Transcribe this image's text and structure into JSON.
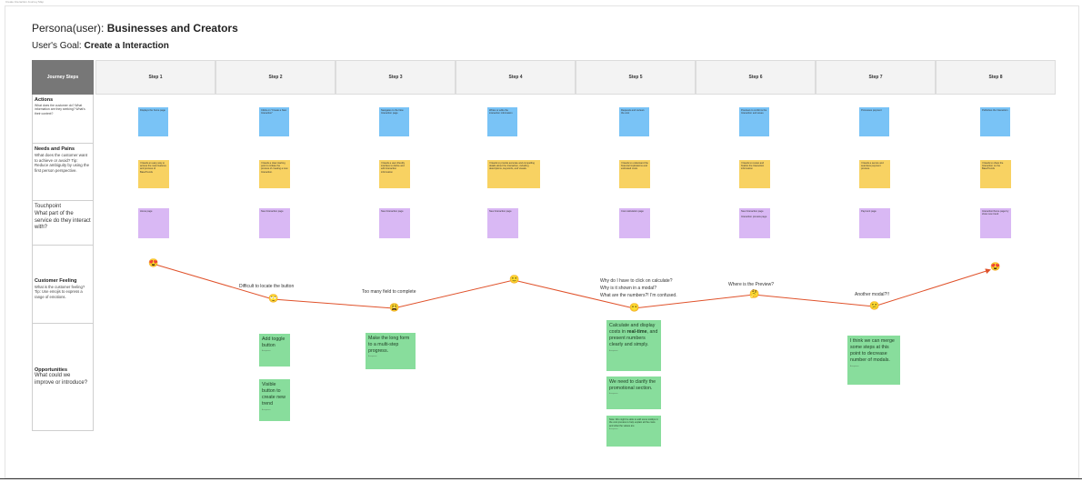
{
  "tiny_label": "Create Interaction Journey Map",
  "persona": {
    "prefix": "Persona(user): ",
    "name": "Businesses and Creators"
  },
  "goal": {
    "prefix": "User's Goal: ",
    "name": "Create a Interaction"
  },
  "journey_label": "Journey Steps",
  "steps": [
    "Step 1",
    "Step 2",
    "Step 3",
    "Step 4",
    "Step 5",
    "Step 6",
    "Step 7",
    "Step 8"
  ],
  "rows": {
    "actions": {
      "title": "Actions",
      "desc": "What does the customer do? What information are they seeking? What's their context?"
    },
    "needs": {
      "title": "Needs and Pains",
      "desc": "What does the customer want to achieve or avoid? Tip: Reduce ambiguity by using the first person perspective."
    },
    "touchpoint": {
      "title": "Touchpoint",
      "desc": "What part of the service do they interact with?"
    },
    "feeling": {
      "title": "Customer Feeling",
      "desc": "What is the customer feeling? Tip: Use emojis to express a range of emotions."
    },
    "opportunities": {
      "title": "Opportunities",
      "desc": "What could we improve or introduce?"
    }
  },
  "actions": [
    "Displays the home page",
    "Clicks on \"Create a New Interaction\"",
    "Navigates to the New Interaction page",
    "Writes or edits the interaction information",
    "Requests and reviews the cost",
    "Previews to confirms the Interaction and saves",
    "Processes payment",
    "Publishes the Interaction"
  ],
  "needs": [
    "I Needs an easy way to access the main features and process of BaseTrends",
    "I Needs a clear starting point to initiate the process of creating a new Interaction.",
    "I Needs a user-friendly interface to define and edit Interaction information",
    "I Needs to provide accurate and compelling details about the Interaction, including descriptions, keywords, and visuals.",
    "I Needs to understand the financial implications and estimated costs",
    "I Needs to review and finalize the Interaction information",
    "I Needs a secure and seamless payment process.",
    "I Needs to share the Interaction on the BaseTrends"
  ],
  "touchpoints": [
    "Home page",
    "New Interaction page",
    "New Interaction page",
    "New Interaction page",
    "Cost calculation page",
    "New Interaction page\n\nInteraction preview page",
    "Payment page",
    "Interaction/home page by show new trend"
  ],
  "feelings": [
    {
      "emoji": "😍",
      "label": ""
    },
    {
      "emoji": "🙄",
      "label": "Difficult to locate the button"
    },
    {
      "emoji": "😩",
      "label": "Too many field to complete"
    },
    {
      "emoji": "🙂",
      "label": ""
    },
    {
      "emoji": "😶",
      "label": "Why do I have to click on calculate?\nWhy is it shown in a modal?\nWhat are the numbers?! I'm confused."
    },
    {
      "emoji": "🤔",
      "label": "Where is the Preview?"
    },
    {
      "emoji": "😕",
      "label": "Another modal?!!"
    },
    {
      "emoji": "😍",
      "label": ""
    }
  ],
  "opportunities": [
    {
      "text": "Add toggle button",
      "sig": "Anonymous"
    },
    {
      "text": "Visible button to create new trend",
      "sig": "Anonymous"
    },
    {
      "text": "Make the long form to a multi-step progress.",
      "sig": "Anonymous"
    },
    {
      "text_pre": "Calculate and display costs in ",
      "text_bold": "real-time",
      "text_post": ", and present numbers clearly and simply.",
      "sig": "Anonymous"
    },
    {
      "text": "We need to clarify the promotional section.",
      "sig": "Anonymous"
    },
    {
      "text": "Note: We might be able to add some tooltips in the cost preview to help explain all the costs and what the values are",
      "sig": "Anonymous"
    },
    {
      "text": "I think we can merge some steps at this point to decrease number of modals.",
      "sig": "Anonymous"
    }
  ],
  "colors": {
    "actions": "#79c3f6",
    "needs": "#f8d262",
    "touchpoints": "#d9b8f4",
    "opportunities": "#88dd9c",
    "curve": "#e0522b"
  }
}
